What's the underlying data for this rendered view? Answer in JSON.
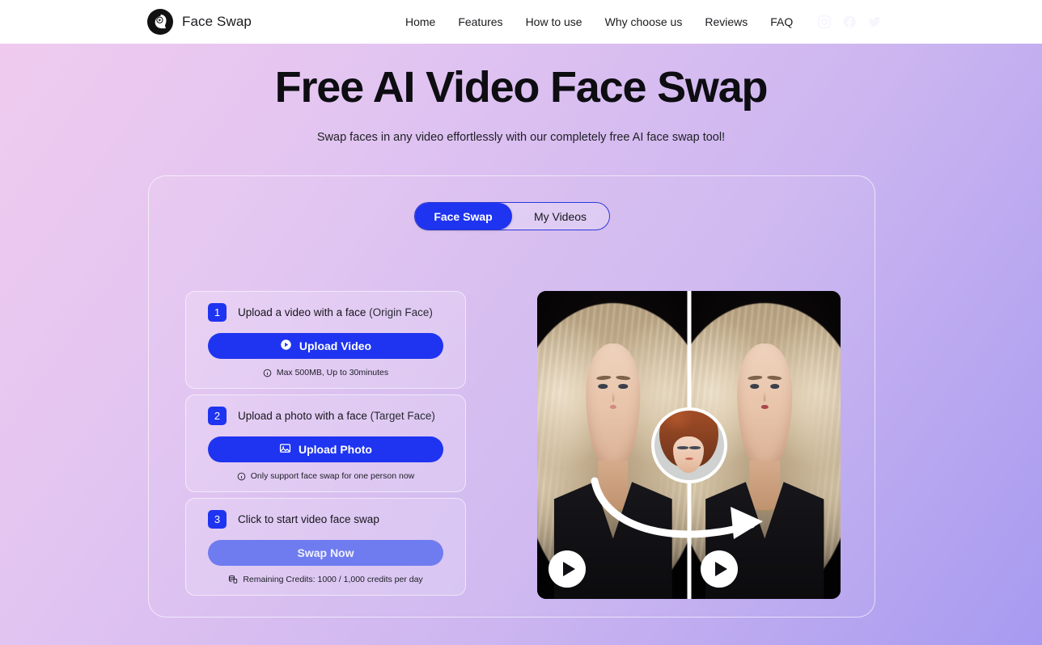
{
  "header": {
    "brand_name": "Face Swap",
    "logo_icon": "face-play-logo-icon",
    "nav_items": [
      {
        "label": "Home"
      },
      {
        "label": "Features"
      },
      {
        "label": "How to use"
      },
      {
        "label": "Why choose us"
      },
      {
        "label": "Reviews"
      },
      {
        "label": "FAQ"
      }
    ],
    "socials": [
      {
        "name": "instagram-icon"
      },
      {
        "name": "facebook-icon"
      },
      {
        "name": "twitter-icon"
      }
    ]
  },
  "hero": {
    "title": "Free AI Video Face Swap",
    "subtitle": "Swap faces in any video effortlessly with our completely free AI face swap tool!"
  },
  "tabs": [
    {
      "label": "Face Swap",
      "active": true
    },
    {
      "label": "My Videos",
      "active": false
    }
  ],
  "steps": [
    {
      "number": "1",
      "label": "Upload a video with a face",
      "paren": "(Origin Face)",
      "button_label": "Upload Video",
      "button_icon": "play-circle-icon",
      "button_state": "enabled",
      "hint_icon": "info-icon",
      "hint": "Max 500MB, Up to 30minutes"
    },
    {
      "number": "2",
      "label": "Upload a photo with a face",
      "paren": "(Target Face)",
      "button_label": "Upload Photo",
      "button_icon": "image-icon",
      "button_state": "enabled",
      "hint_icon": "info-icon",
      "hint": "Only support face swap for one person now"
    },
    {
      "number": "3",
      "label": "Click to start video face swap",
      "paren": "",
      "button_label": "Swap Now",
      "button_icon": "none",
      "button_state": "disabled",
      "hint_icon": "credits-stack-icon",
      "hint": "Remaining Credits:  1000 / 1,000 credits per day"
    }
  ],
  "preview": {
    "alt": "before and after face swap comparison video",
    "left_play_icon": "play-icon",
    "right_play_icon": "play-icon",
    "center_thumb": "target-face-thumbnail",
    "arrow_icon": "curved-swap-arrow-icon"
  },
  "colors": {
    "accent_blue": "#1f34f0",
    "disabled_blue": "#6f7cef",
    "bg_start": "#f0cbee",
    "bg_end": "#a79af0",
    "text_dark": "#16161c"
  }
}
